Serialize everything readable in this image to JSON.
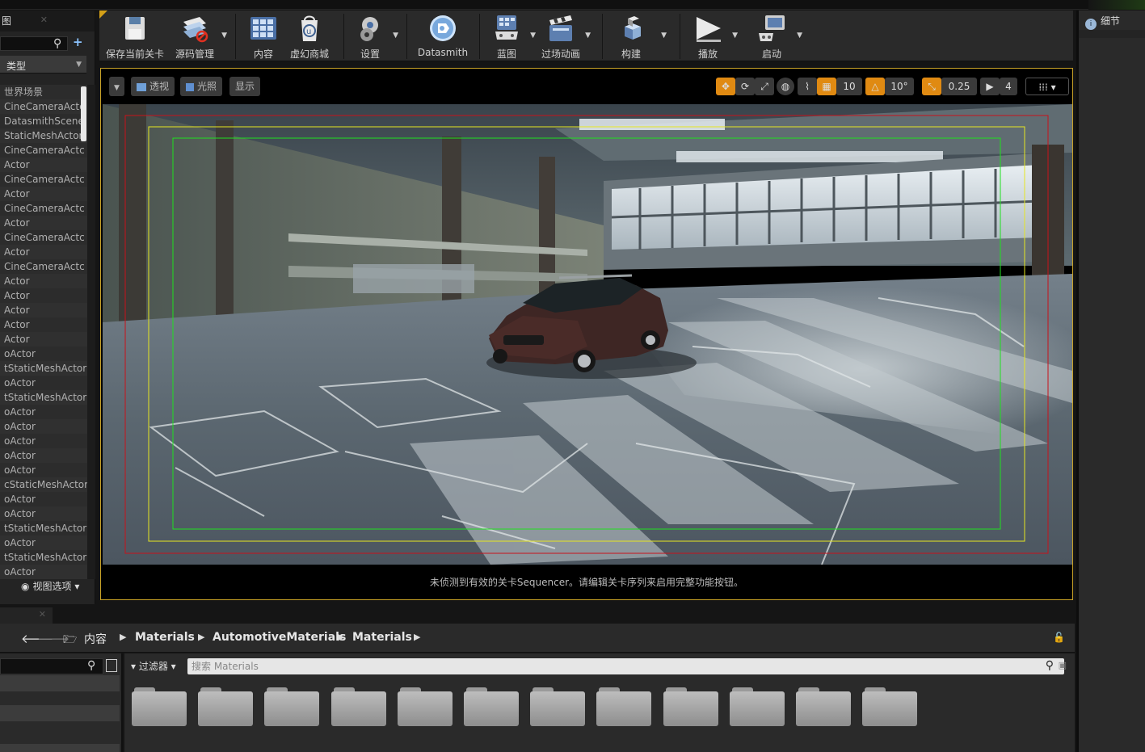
{
  "outliner": {
    "tab_title": "图",
    "close": "✕",
    "column_header": "类型",
    "rows": [
      "世界场景",
      "CineCameraActc",
      "DatasmithScene",
      "StaticMeshActor",
      "CineCameraActc",
      "Actor",
      "CineCameraActc",
      "Actor",
      "CineCameraActc",
      "Actor",
      "CineCameraActc",
      "Actor",
      "CineCameraActc",
      "Actor",
      "Actor",
      "Actor",
      "Actor",
      "Actor",
      "oActor",
      "tStaticMeshActor",
      "oActor",
      "tStaticMeshActor",
      "oActor",
      "oActor",
      "oActor",
      "oActor",
      "oActor",
      "cStaticMeshActor",
      "oActor",
      "oActor",
      "tStaticMeshActor",
      "oActor",
      "tStaticMeshActor",
      "oActor"
    ],
    "view_options": "视图选项"
  },
  "toolbar": {
    "buttons": [
      {
        "label": "保存当前关卡"
      },
      {
        "label": "源码管理"
      },
      {
        "label": "内容"
      },
      {
        "label": "虚幻商城"
      },
      {
        "label": "设置"
      },
      {
        "label": "Datasmith"
      },
      {
        "label": "蓝图"
      },
      {
        "label": "过场动画"
      },
      {
        "label": "构建"
      },
      {
        "label": "播放"
      },
      {
        "label": "启动"
      }
    ]
  },
  "viewport": {
    "perspective": "透视",
    "lighting": "光照",
    "show": "显示",
    "grid_snap": "10",
    "rot_snap": "10°",
    "scale_snap": "0.25",
    "cam_speed": "4",
    "message": "未侦测到有效的关卡Sequencer。请编辑关卡序列来启用完整功能按钮。"
  },
  "content_browser": {
    "path": [
      "内容",
      "Materials",
      "AutomotiveMaterials",
      "Materials"
    ],
    "filter_label": "过滤器",
    "search_placeholder": "搜索 Materials",
    "folder_count": 12
  },
  "details": {
    "tab_title": "细节"
  },
  "colors": {
    "viewport_border": "#c9a227",
    "accent_orange": "#e08a12",
    "safe_red": "#c8121a",
    "safe_yellow": "#e6e621",
    "safe_green": "#1fe01f"
  }
}
